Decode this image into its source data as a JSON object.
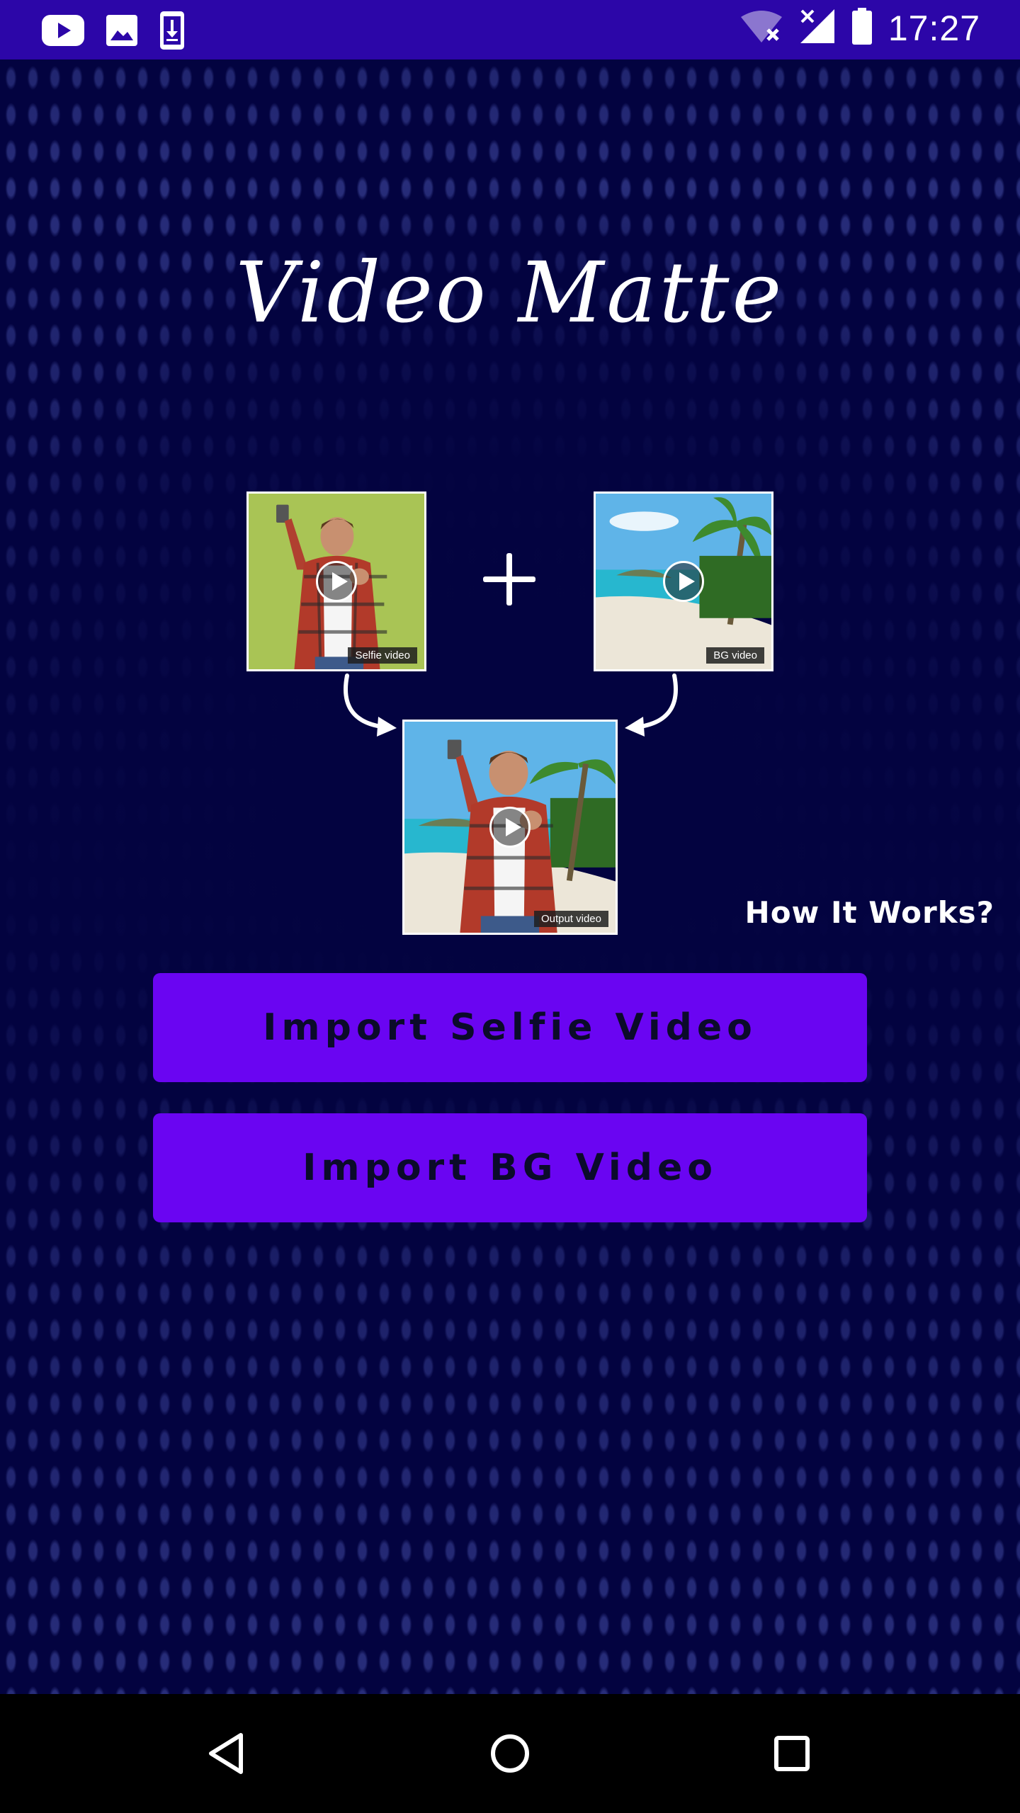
{
  "status_bar": {
    "time": "17:27",
    "left_icons": [
      "youtube-icon",
      "gallery-icon",
      "download-icon"
    ],
    "right_icons": [
      "wifi-off-icon",
      "signal-icon",
      "battery-icon"
    ]
  },
  "app": {
    "title": "Video Matte"
  },
  "demo": {
    "selfie_label": "Selfie video",
    "bg_label": "BG video",
    "output_label": "Output video"
  },
  "how_it_works": "How It Works?",
  "buttons": {
    "import_selfie": "Import Selfie Video",
    "import_bg": "Import BG Video"
  },
  "nav": {
    "icons": [
      "back-icon",
      "home-icon",
      "recents-icon"
    ]
  },
  "colors": {
    "status_bar": "#2c06a8",
    "background": "#030340",
    "button": "#6a05f2",
    "button_text": "#0b0b2a"
  }
}
